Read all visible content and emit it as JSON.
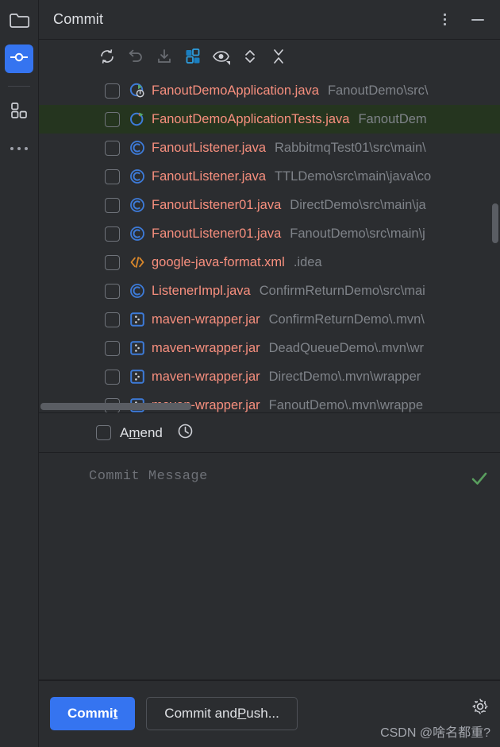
{
  "window": {
    "tool_title": "Commit",
    "more_options_icon": "vertical-ellipsis-icon",
    "minimize_icon": "minimize-icon"
  },
  "rail": {
    "items": [
      {
        "icon": "project-folder-icon",
        "name": "project",
        "active": false
      },
      {
        "icon": "commit-icon",
        "name": "commit",
        "active": true
      },
      {
        "icon": "structure-icon",
        "name": "structure",
        "active": false
      },
      {
        "icon": "more-tool-windows-icon",
        "name": "more",
        "active": false
      }
    ]
  },
  "toolbar": {
    "buttons": [
      {
        "name": "refresh-changes",
        "icon": "refresh-icon",
        "enabled": true
      },
      {
        "name": "rollback",
        "icon": "undo-icon",
        "enabled": false
      },
      {
        "name": "update-project",
        "icon": "download-icon",
        "enabled": false
      },
      {
        "name": "group-by",
        "icon": "group-by-icon",
        "enabled": true
      },
      {
        "name": "show-diff-preview",
        "icon": "eye-icon",
        "enabled": true
      },
      {
        "name": "expand-collapse",
        "icon": "chevron-updown-icon",
        "enabled": true
      },
      {
        "name": "collapse-all",
        "icon": "collapse-all-icon",
        "enabled": true
      }
    ]
  },
  "colors": {
    "accent": "#3574f0",
    "file_name": "#f78f7e",
    "file_path": "#7f8389",
    "selected_row": "#25351f",
    "panel_bg": "#2b2d30",
    "check_green": "#599e5e"
  },
  "file_list": {
    "rows": [
      {
        "checked": false,
        "icon": "spring-boot-class-icon",
        "name": "FanoutDemoApplication.java",
        "path": "FanoutDemo\\src\\",
        "selected": false
      },
      {
        "checked": false,
        "icon": "test-class-icon",
        "name": "FanoutDemoApplicationTests.java",
        "path": "FanoutDem",
        "selected": true
      },
      {
        "checked": false,
        "icon": "java-class-icon",
        "name": "FanoutListener.java",
        "path": "RabbitmqTest01\\src\\main\\",
        "selected": false
      },
      {
        "checked": false,
        "icon": "java-class-icon",
        "name": "FanoutListener.java",
        "path": "TTLDemo\\src\\main\\java\\co",
        "selected": false
      },
      {
        "checked": false,
        "icon": "java-class-icon",
        "name": "FanoutListener01.java",
        "path": "DirectDemo\\src\\main\\ja",
        "selected": false
      },
      {
        "checked": false,
        "icon": "java-class-icon",
        "name": "FanoutListener01.java",
        "path": "FanoutDemo\\src\\main\\j",
        "selected": false
      },
      {
        "checked": false,
        "icon": "xml-file-icon",
        "name": "google-java-format.xml",
        "path": ".idea",
        "selected": false
      },
      {
        "checked": false,
        "icon": "java-class-icon",
        "name": "ListenerImpl.java",
        "path": "ConfirmReturnDemo\\src\\mai",
        "selected": false
      },
      {
        "checked": false,
        "icon": "jar-file-icon",
        "name": "maven-wrapper.jar",
        "path": "ConfirmReturnDemo\\.mvn\\",
        "selected": false
      },
      {
        "checked": false,
        "icon": "jar-file-icon",
        "name": "maven-wrapper.jar",
        "path": "DeadQueueDemo\\.mvn\\wr",
        "selected": false
      },
      {
        "checked": false,
        "icon": "jar-file-icon",
        "name": "maven-wrapper.jar",
        "path": "DirectDemo\\.mvn\\wrapper",
        "selected": false
      },
      {
        "checked": false,
        "icon": "jar-file-icon",
        "name": "maven-wrapper.jar",
        "path": "FanoutDemo\\.mvn\\wrappe",
        "selected": false
      }
    ]
  },
  "amend": {
    "checked": false,
    "label_before": "A",
    "label_mnemonic": "m",
    "label_after": "end",
    "history_icon": "clock-history-icon"
  },
  "commit_message": {
    "placeholder": "Commit Message",
    "value": "",
    "check_icon": "green-check-icon"
  },
  "footer": {
    "commit_before": "Commi",
    "commit_mnemonic": "t",
    "commit_after": "",
    "push_before": "Commit and ",
    "push_mnemonic": "P",
    "push_after": "ush...",
    "settings_icon": "gear-icon"
  },
  "watermark": {
    "text": "CSDN @啥名都重?"
  }
}
